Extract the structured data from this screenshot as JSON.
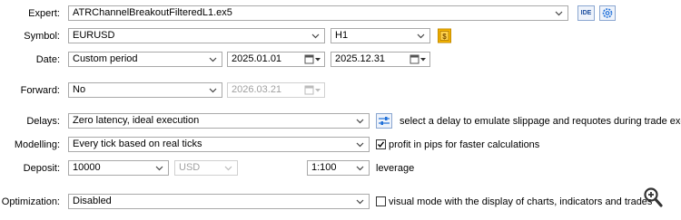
{
  "expert": {
    "label": "Expert:",
    "value": "ATRChannelBreakoutFilteredL1.ex5",
    "ide_label": "IDE",
    "icon": "settings-gear-icon"
  },
  "symbol": {
    "label": "Symbol:",
    "value": "EURUSD",
    "timeframe": "H1",
    "icon": "dollar-symbol-icon"
  },
  "date": {
    "label": "Date:",
    "period": "Custom period",
    "from": "2025.01.01",
    "to": "2025.12.31"
  },
  "forward": {
    "label": "Forward:",
    "value": "No",
    "date": "2026.03.21"
  },
  "delays": {
    "label": "Delays:",
    "value": "Zero latency, ideal execution",
    "hint": "select a delay to emulate slippage and requotes during trade execution"
  },
  "modelling": {
    "label": "Modelling:",
    "value": "Every tick based on real ticks",
    "profit_pips_label": "profit in pips for faster calculations",
    "profit_pips_checked": true
  },
  "deposit": {
    "label": "Deposit:",
    "amount": "10000",
    "currency": "USD",
    "leverage_value": "1:100",
    "leverage_label": "leverage"
  },
  "optimization": {
    "label": "Optimization:",
    "value": "Disabled",
    "visual_mode_label": "visual mode with the display of charts, indicators and trades",
    "visual_mode_checked": false
  },
  "colors": {
    "accent_blue": "#1e6fd9",
    "symbol_icon_bg": "#f5b400",
    "border": "#a9a9a9",
    "disabled_text": "#a0a0a0"
  }
}
